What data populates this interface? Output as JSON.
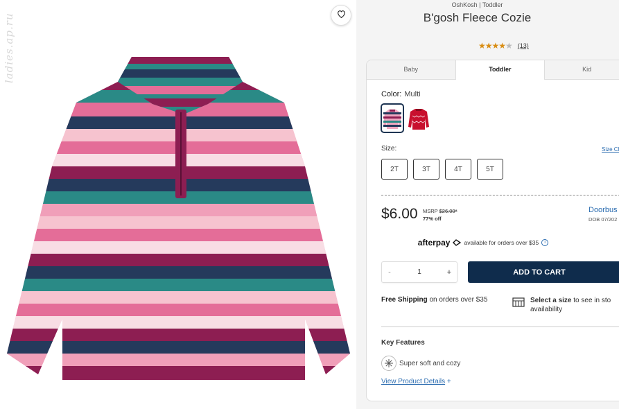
{
  "image": {
    "watermark": "ladies.ap.ru",
    "wishlist_icon": "heart-icon"
  },
  "product": {
    "breadcrumb": "OshKosh | Toddler",
    "title": "B'gosh Fleece Cozie",
    "rating": 4,
    "review_count": "(13)"
  },
  "tabs": [
    {
      "label": "Baby",
      "active": false
    },
    {
      "label": "Toddler",
      "active": true
    },
    {
      "label": "Kid",
      "active": false
    }
  ],
  "color": {
    "label": "Color:",
    "value": "Multi",
    "swatches": [
      "multi-stripe",
      "red-fair-isle"
    ]
  },
  "size": {
    "label": "Size:",
    "chart_link": "Size Ch",
    "options": [
      "2T",
      "3T",
      "4T",
      "5T"
    ]
  },
  "price": {
    "current": "$6.00",
    "msrp_label": "MSRP",
    "msrp_value": "$26.00*",
    "discount": "77% off",
    "doorbuster": "Doorbus",
    "dob": "DOB 07/202"
  },
  "afterpay": {
    "brand": "afterpay",
    "text": "available for orders over $35",
    "info_icon": "info-icon"
  },
  "cart": {
    "minus": "-",
    "quantity": "1",
    "plus": "+",
    "add_label": "ADD TO CART"
  },
  "shipping": {
    "bold": "Free Shipping",
    "text": "on orders over $35"
  },
  "store": {
    "bold": "Select a size",
    "text": "to see in sto",
    "line2": "availability"
  },
  "features": {
    "title": "Key Features",
    "items": [
      "Super soft and cozy"
    ],
    "view_details": "View Product Details",
    "view_plus": "+"
  }
}
